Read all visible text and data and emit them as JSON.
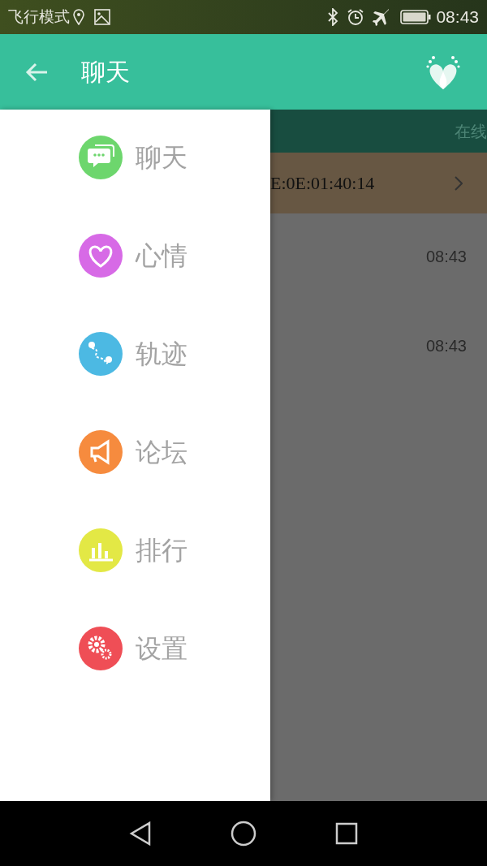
{
  "status_bar": {
    "mode_text": "飞行模式",
    "time": "08:43"
  },
  "app_bar": {
    "title": "聊天"
  },
  "background": {
    "tab_label": "在线",
    "device_row": {
      "text": "E:0E:01:40:14"
    },
    "times": [
      "08:43",
      "08:43"
    ]
  },
  "drawer": {
    "items": [
      {
        "label": "聊天",
        "color": "#6dd66d"
      },
      {
        "label": "心情",
        "color": "#d76ae6"
      },
      {
        "label": "轨迹",
        "color": "#4cb9e3"
      },
      {
        "label": "论坛",
        "color": "#f68b3e"
      },
      {
        "label": "排行",
        "color": "#e3e845"
      },
      {
        "label": "设置",
        "color": "#ef4e56"
      }
    ]
  }
}
